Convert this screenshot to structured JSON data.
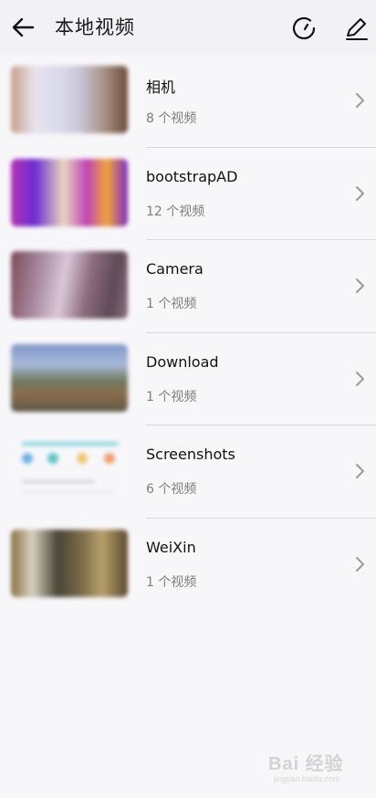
{
  "header": {
    "title": "本地视频",
    "back_icon": "arrow-left-icon",
    "sync_icon": "refresh-icon",
    "edit_icon": "pencil-icon"
  },
  "folders": [
    {
      "name": "相机",
      "count": "8 个视频"
    },
    {
      "name": "bootstrapAD",
      "count": "12 个视频"
    },
    {
      "name": "Camera",
      "count": "1 个视频"
    },
    {
      "name": "Download",
      "count": "1 个视频"
    },
    {
      "name": "Screenshots",
      "count": "6 个视频"
    },
    {
      "name": "WeiXin",
      "count": "1 个视频"
    }
  ],
  "watermark": {
    "text": "Bai 经验",
    "url": "jingyan.baidu.com"
  },
  "colors": {
    "background": "#f7f6f9",
    "header": "#f2f1f5",
    "divider": "#d9d8dc",
    "secondary_text": "#7d7d7d"
  }
}
